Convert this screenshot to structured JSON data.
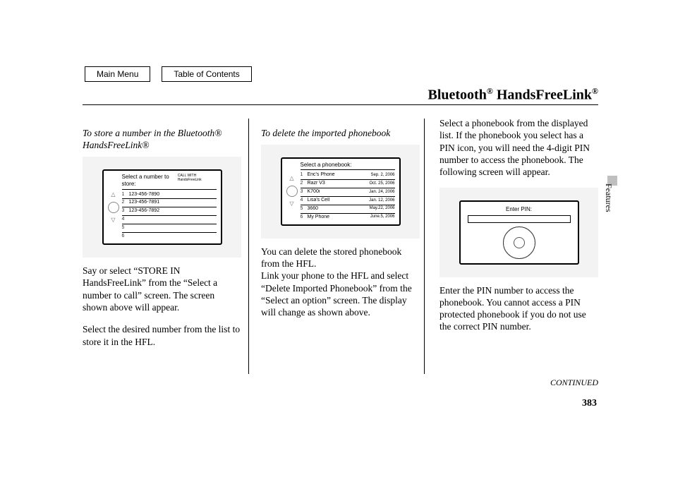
{
  "nav": {
    "main_menu": "Main Menu",
    "toc": "Table of Contents"
  },
  "title_parts": {
    "a": "Bluetooth",
    "b": " HandsFreeLink"
  },
  "side_tab": "Features",
  "pagenum": "383",
  "continued": "CONTINUED",
  "col1": {
    "heading": "To store a number in the Bluetooth® HandsFreeLink®",
    "screen_title": "Select a number to store:",
    "screen_tag": "CALL WITH HandsFreeLink",
    "rows": [
      {
        "idx": "1",
        "txt": "123-456-7890"
      },
      {
        "idx": "2",
        "txt": "123-456-7891"
      },
      {
        "idx": "3",
        "txt": "123-456-7892"
      },
      {
        "idx": "4",
        "txt": ""
      },
      {
        "idx": "5",
        "txt": ""
      },
      {
        "idx": "6",
        "txt": ""
      }
    ],
    "p1": "Say or select “STORE IN HandsFreeLink” from the “Select a number to call” screen. The screen shown above will appear.",
    "p2": "Select the desired number from the list to store it in the HFL."
  },
  "col2": {
    "heading": "To delete the imported phonebook",
    "screen_title": "Select a phonebook:",
    "rows": [
      {
        "idx": "1",
        "txt": "Eric's Phone",
        "date": "Sep. 2, 2006"
      },
      {
        "idx": "2",
        "txt": "Razr V3",
        "date": "Oct. 25, 2006"
      },
      {
        "idx": "3",
        "txt": "K700i",
        "date": "Jan. 24, 2006"
      },
      {
        "idx": "4",
        "txt": "Lisa's Cell",
        "date": "Jan. 12, 2006"
      },
      {
        "idx": "5",
        "txt": "3660",
        "date": "May.22, 2006"
      },
      {
        "idx": "6",
        "txt": "My Phone",
        "date": "June.5, 2006"
      }
    ],
    "p1": "You can delete the stored phonebook from the HFL.",
    "p2": "Link your phone to the HFL and select “Delete Imported Phonebook” from the “Select an option” screen. The display will change as shown above."
  },
  "col3": {
    "p1": "Select a phonebook from the displayed list. If the phonebook you select has a PIN icon, you will need the 4-digit PIN number to access the phonebook. The following screen will appear.",
    "pin_title": "Enter PIN:",
    "p2": "Enter the PIN number to access the phonebook. You cannot access a PIN protected phonebook if you do not use the correct PIN number."
  }
}
